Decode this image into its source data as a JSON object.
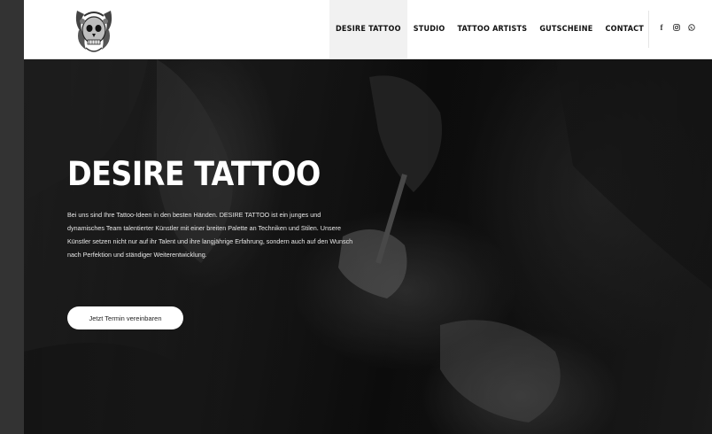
{
  "nav": {
    "items": [
      {
        "label": "DESIRE TATTOO",
        "active": true
      },
      {
        "label": "STUDIO",
        "active": false
      },
      {
        "label": "TATTOO ARTISTS",
        "active": false
      },
      {
        "label": "GUTSCHEINE",
        "active": false
      },
      {
        "label": "CONTACT",
        "active": false
      }
    ]
  },
  "social": {
    "facebook_glyph": "f",
    "instagram_glyph": "◎",
    "whatsapp_glyph": "✆",
    "icons": [
      "facebook-icon",
      "instagram-icon",
      "whatsapp-icon"
    ]
  },
  "hero": {
    "title": "DESIRE TATTOO",
    "text": "Bei uns sind Ihre Tattoo-Ideen in den besten Händen. DESIRE TATTOO ist ein junges und dynamisches Team talentierter Künstler mit einer breiten Palette an Techniken und Stilen. Unsere Künstler setzen nicht nur auf ihr Talent und ihre langjährige Erfahrung, sondern auch auf den Wunsch nach Perfektion und ständiger Weiterentwicklung.",
    "cta_label": "Jetzt Termin vereinbaren"
  },
  "colors": {
    "header_bg": "#ffffff",
    "nav_active_bg": "#f1f1f1",
    "hero_text": "#ffffff",
    "button_bg": "#ffffff"
  }
}
